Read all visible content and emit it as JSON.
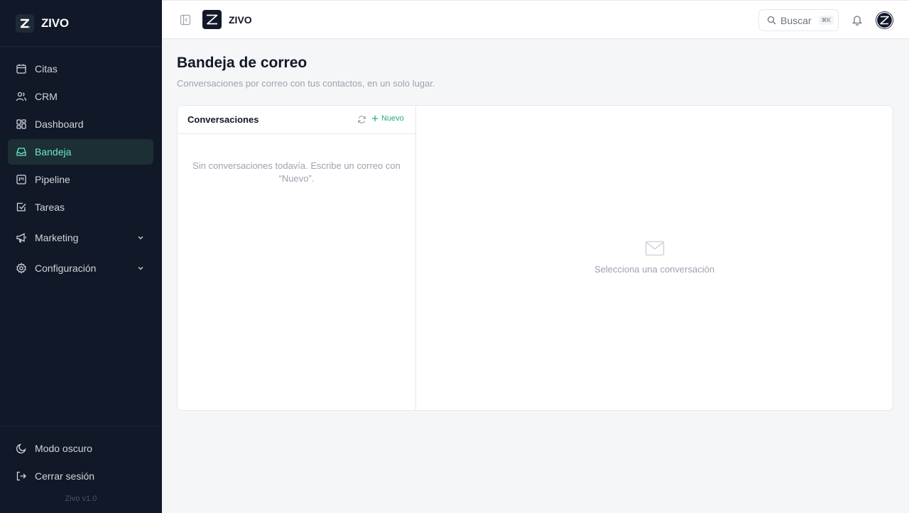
{
  "brand": {
    "name": "ZIVO"
  },
  "sidebar": {
    "items": [
      {
        "label": "Citas",
        "icon": "calendar-icon"
      },
      {
        "label": "CRM",
        "icon": "users-icon"
      },
      {
        "label": "Dashboard",
        "icon": "dashboard-icon"
      },
      {
        "label": "Bandeja",
        "icon": "inbox-icon",
        "active": true
      },
      {
        "label": "Pipeline",
        "icon": "pipeline-icon"
      },
      {
        "label": "Tareas",
        "icon": "tasks-icon"
      },
      {
        "label": "Marketing",
        "icon": "megaphone-icon",
        "expandable": true
      },
      {
        "label": "Configuración",
        "icon": "gear-icon",
        "expandable": true
      }
    ],
    "bottom": [
      {
        "label": "Modo oscuro",
        "icon": "moon-icon"
      },
      {
        "label": "Cerrar sesión",
        "icon": "logout-icon"
      }
    ],
    "version": "Zivo v1.0"
  },
  "topbar": {
    "brand": "ZIVO",
    "search": {
      "placeholder": "Buscar",
      "shortcut": "⌘K"
    }
  },
  "page": {
    "title": "Bandeja de correo",
    "subtitle": "Conversaciones por correo con tus contactos, en un solo lugar."
  },
  "conversations": {
    "title": "Conversaciones",
    "new_label": "Nuevo",
    "empty": "Sin conversaciones todavía. Escribe un correo con “Nuevo”."
  },
  "detail": {
    "empty": "Selecciona una conversación"
  },
  "colors": {
    "sidebar_bg": "#111827",
    "accent": "#2aa889",
    "active_bg": "#1c2f34",
    "active_text": "#6ee7c7"
  }
}
